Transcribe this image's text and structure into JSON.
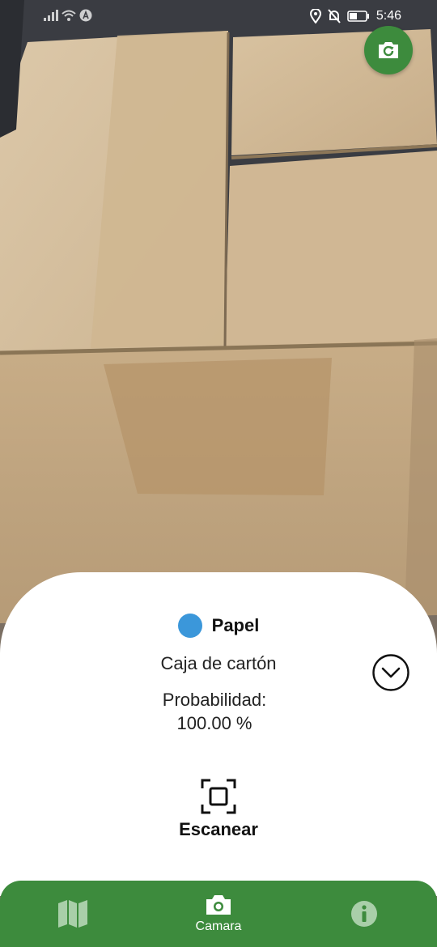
{
  "status_bar": {
    "time": "5:46",
    "icons": [
      "signal-icon",
      "wifi-icon",
      "data-icon",
      "location-icon",
      "silent-icon",
      "battery-icon"
    ]
  },
  "camera": {
    "switch_icon": "camera-switch-icon",
    "subject": "cardboard-box"
  },
  "result": {
    "category_label": "Papel",
    "category_color": "#3b97da",
    "item_name": "Caja de cartón",
    "probability_label": "Probabilidad:",
    "probability_value": "100.00 %",
    "expand_icon": "chevron-down-circle-icon",
    "scan_label": "Escanear",
    "scan_icon": "scan-frame-icon"
  },
  "bottom_nav": {
    "items": [
      {
        "id": "map",
        "label": "",
        "icon": "map-icon",
        "active": false
      },
      {
        "id": "camera",
        "label": "Camara",
        "icon": "camera-icon",
        "active": true
      },
      {
        "id": "info",
        "label": "",
        "icon": "info-icon",
        "active": false
      }
    ]
  },
  "colors": {
    "accent": "#3d8b3d",
    "inactive_nav": "#a9cfa9"
  }
}
